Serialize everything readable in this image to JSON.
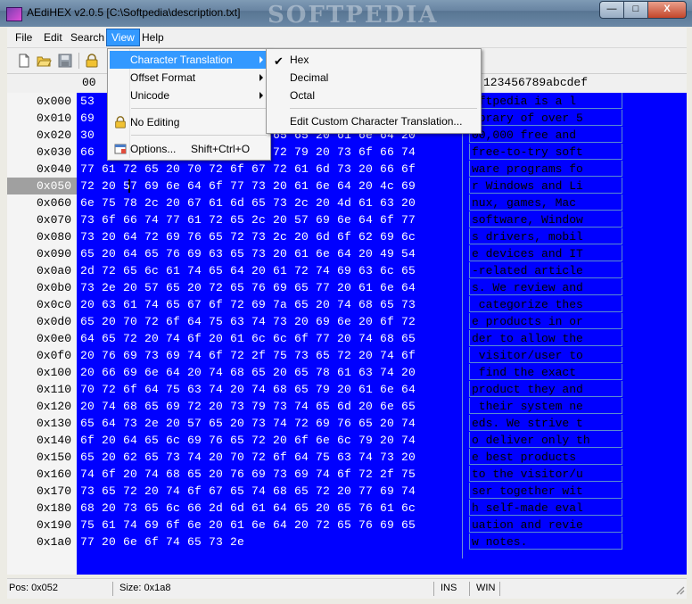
{
  "window": {
    "title": "AEdiHEX v2.0.5 [C:\\Softpedia\\description.txt]",
    "watermark": "SOFTPEDIA"
  },
  "caption": {
    "minimize": "—",
    "maximize": "□",
    "close": "X"
  },
  "menubar": [
    "File",
    "Edit",
    "Search",
    "View",
    "Help"
  ],
  "view_menu": {
    "items": [
      {
        "label": "Character Translation",
        "submenu": true,
        "highlighted": true
      },
      {
        "label": "Offset Format",
        "submenu": true
      },
      {
        "label": "Unicode",
        "submenu": true
      },
      {
        "label": "No Editing",
        "icon": "lock-icon"
      },
      {
        "label": "Options...",
        "accel": "Shift+Ctrl+O",
        "icon": "options-icon"
      }
    ]
  },
  "char_translation_submenu": {
    "items": [
      {
        "label": "Hex",
        "checked": true
      },
      {
        "label": "Decimal"
      },
      {
        "label": "Octal"
      },
      {
        "label": "Edit Custom Character Translation..."
      }
    ]
  },
  "hex_header": {
    "first": "00",
    "ascii": "123456789abcdef"
  },
  "offsets": [
    "0x000",
    "0x010",
    "0x020",
    "0x030",
    "0x040",
    "0x050",
    "0x060",
    "0x070",
    "0x080",
    "0x090",
    "0x0a0",
    "0x0b0",
    "0x0c0",
    "0x0d0",
    "0x0e0",
    "0x0f0",
    "0x100",
    "0x110",
    "0x120",
    "0x130",
    "0x140",
    "0x150",
    "0x160",
    "0x170",
    "0x180",
    "0x190",
    "0x1a0"
  ],
  "selected_offset": "0x050",
  "hex_rows": [
    "53",
    "69",
    "30                      72 65 65 20 61 6e 64 20",
    "66                      74 72 79 20 73 6f 66 74",
    "77 61 72 65 20 70 72 6f 67 72 61 6d 73 20 66 6f",
    "72 20 57 69 6e 64 6f 77 73 20 61 6e 64 20 4c 69",
    "6e 75 78 2c 20 67 61 6d 65 73 2c 20 4d 61 63 20",
    "73 6f 66 74 77 61 72 65 2c 20 57 69 6e 64 6f 77",
    "73 20 64 72 69 76 65 72 73 2c 20 6d 6f 62 69 6c",
    "65 20 64 65 76 69 63 65 73 20 61 6e 64 20 49 54",
    "2d 72 65 6c 61 74 65 64 20 61 72 74 69 63 6c 65",
    "73 2e 20 57 65 20 72 65 76 69 65 77 20 61 6e 64",
    "20 63 61 74 65 67 6f 72 69 7a 65 20 74 68 65 73",
    "65 20 70 72 6f 64 75 63 74 73 20 69 6e 20 6f 72",
    "64 65 72 20 74 6f 20 61 6c 6c 6f 77 20 74 68 65",
    "20 76 69 73 69 74 6f 72 2f 75 73 65 72 20 74 6f",
    "20 66 69 6e 64 20 74 68 65 20 65 78 61 63 74 20",
    "70 72 6f 64 75 63 74 20 74 68 65 79 20 61 6e 64",
    "20 74 68 65 69 72 20 73 79 73 74 65 6d 20 6e 65",
    "65 64 73 2e 20 57 65 20 73 74 72 69 76 65 20 74",
    "6f 20 64 65 6c 69 76 65 72 20 6f 6e 6c 79 20 74",
    "65 20 62 65 73 74 20 70 72 6f 64 75 63 74 73 20",
    "74 6f 20 74 68 65 20 76 69 73 69 74 6f 72 2f 75",
    "73 65 72 20 74 6f 67 65 74 68 65 72 20 77 69 74",
    "68 20 73 65 6c 66 2d 6d 61 64 65 20 65 76 61 6c",
    "75 61 74 69 6f 6e 20 61 6e 64 20 72 65 76 69 65",
    "77 20 6e 6f 74 65 73 2e"
  ],
  "ascii_rows": [
    "oftpedia is a l",
    "ibrary of over 5",
    "00,000 free and",
    "free-to-try soft",
    "ware programs fo",
    "r Windows and Li",
    "nux, games, Mac",
    "software, Window",
    "s drivers, mobil",
    "e devices and IT",
    "-related article",
    "s. We review and",
    " categorize thes",
    "e products in or",
    "der to allow the",
    " visitor/user to",
    " find the exact",
    "product they and",
    " their system ne",
    "eds. We strive t",
    "o deliver only th",
    "e best products",
    "to the visitor/u",
    "ser together wit",
    "h self-made eval",
    "uation and revie",
    "w notes."
  ],
  "status": {
    "pos": "Pos: 0x052",
    "size": "Size: 0x1a8",
    "mode": "INS",
    "platform": "WIN"
  }
}
